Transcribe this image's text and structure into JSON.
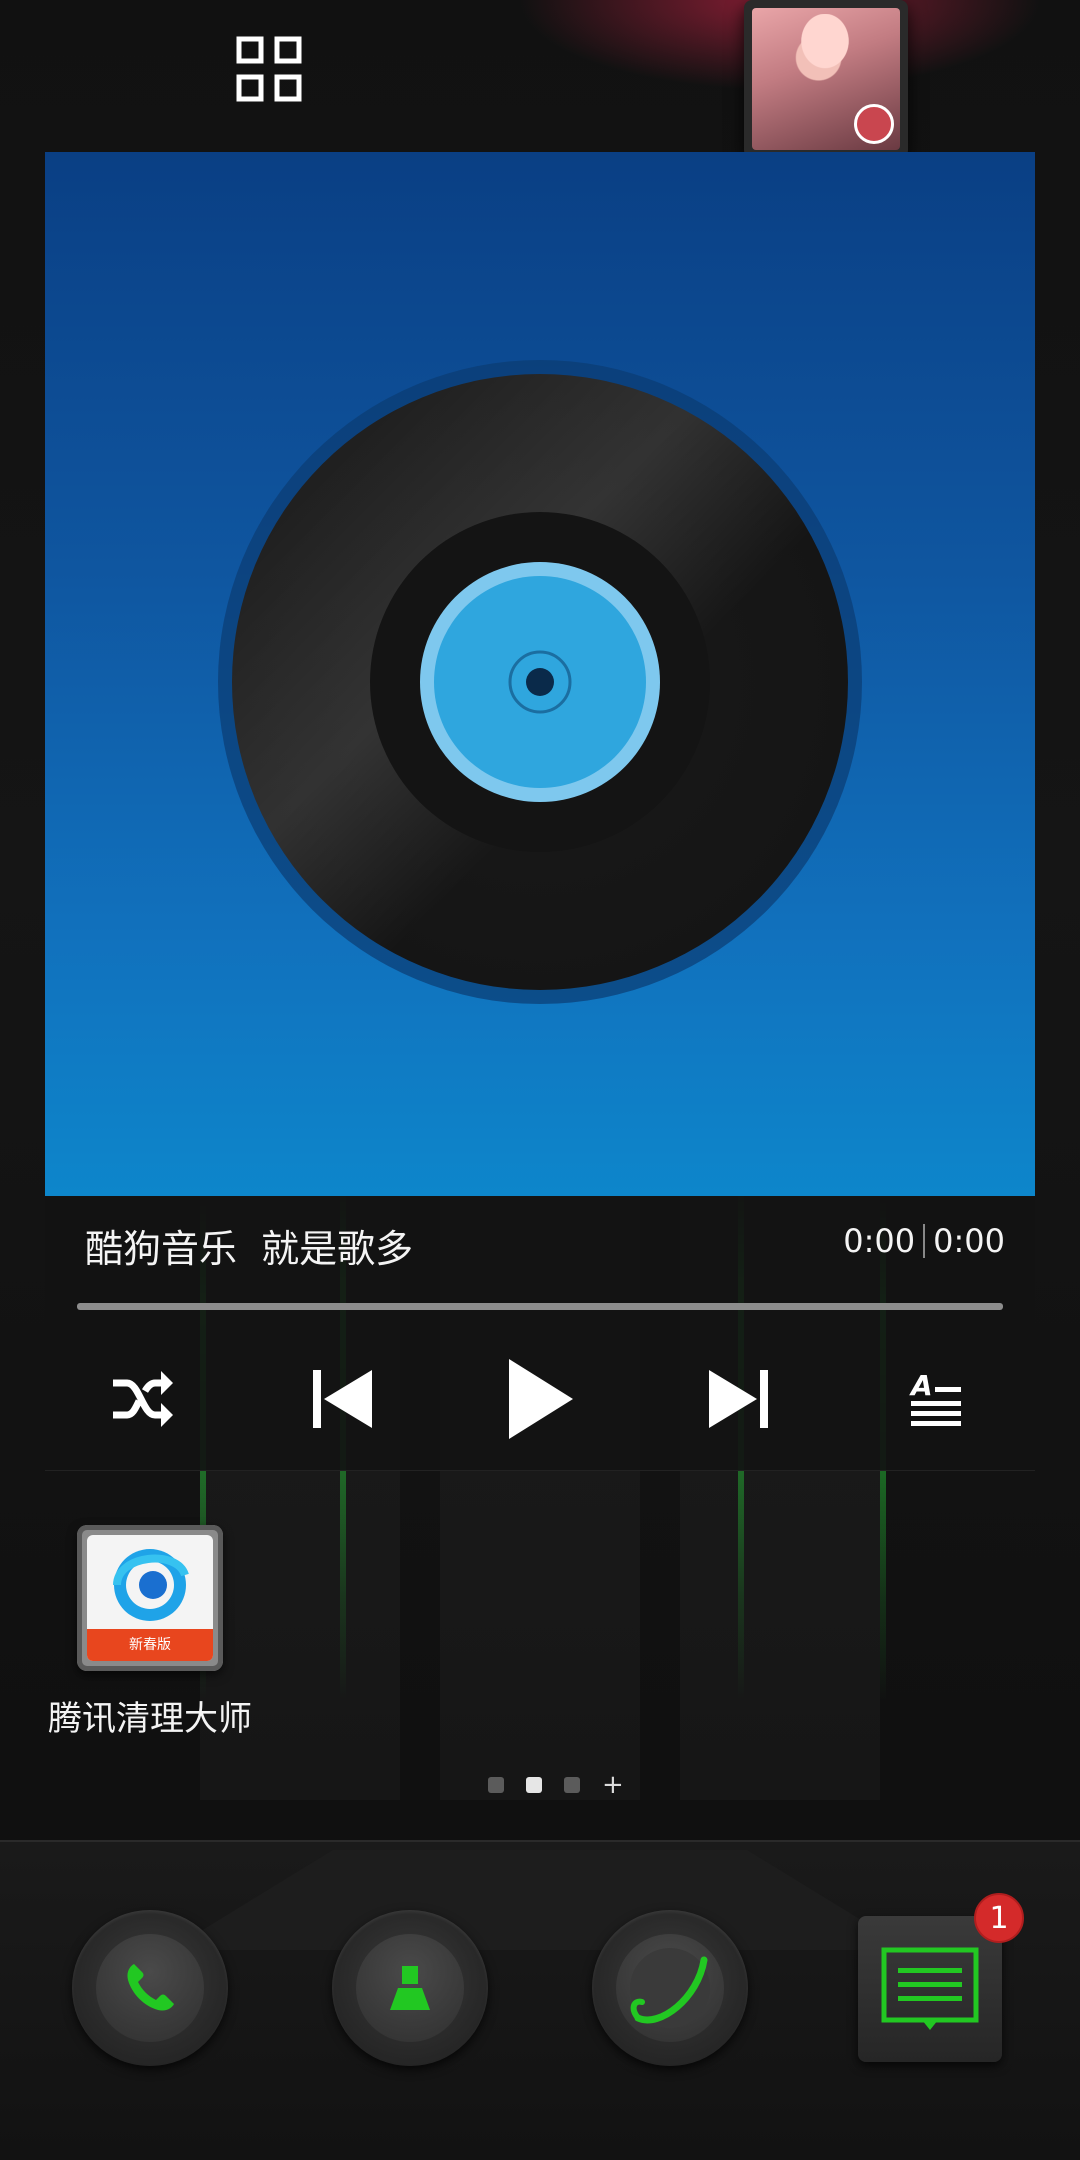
{
  "music_widget": {
    "song_title": "酷狗音乐  就是歌多",
    "time_elapsed": "0:00",
    "time_total": "0:00",
    "progress": 0,
    "controls": {
      "shuffle_icon": "shuffle-icon",
      "previous_icon": "skip-previous-icon",
      "play_icon": "play-icon",
      "next_icon": "skip-next-icon",
      "lyrics_icon": "lyrics-icon"
    },
    "accent_color": "#2fa0e0"
  },
  "desktop_apps": [
    {
      "label": "腾讯清理大师",
      "icon_band_text": "新春版",
      "icon": "tencent-cleaner-icon"
    }
  ],
  "page_indicator": {
    "pages": 3,
    "active_index": 1,
    "add_symbol": "+"
  },
  "dock": {
    "phone_icon": "phone-icon",
    "contacts_icon": "contacts-icon",
    "browser_icon": "browser-icon",
    "messages_icon": "messages-icon",
    "messages_badge": "1"
  },
  "colors": {
    "dock_accent": "#22c822",
    "badge": "#d42a2a"
  }
}
